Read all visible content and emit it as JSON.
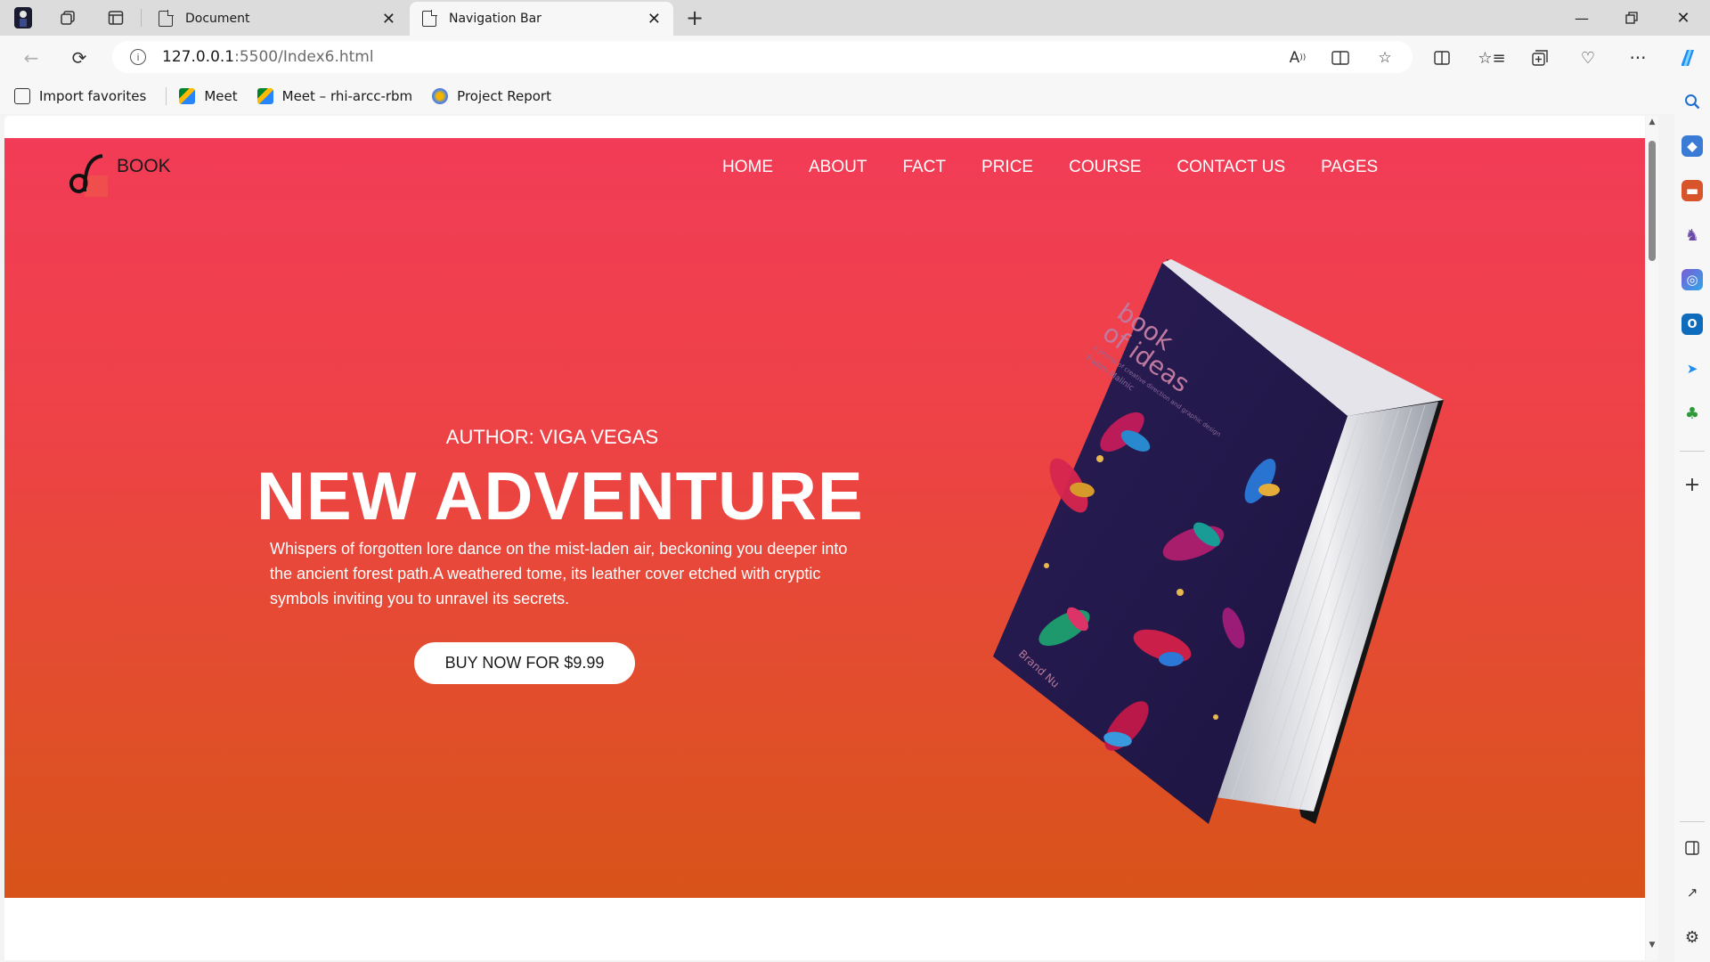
{
  "browser": {
    "tabs": [
      {
        "title": "Document",
        "active": false
      },
      {
        "title": "Navigation Bar",
        "active": true
      }
    ],
    "url_host": "127.0.0.1",
    "url_path": ":5500/Index6.html",
    "favorites": [
      {
        "label": "Import favorites",
        "icon": "import-icon"
      },
      {
        "label": "Meet",
        "icon": "meet-icon"
      },
      {
        "label": "Meet – rhi-arcc-rbm",
        "icon": "meet-icon"
      },
      {
        "label": "Project Report",
        "icon": "report-icon"
      }
    ]
  },
  "page": {
    "brand": "BOOK",
    "menu": [
      "HOME",
      "ABOUT",
      "FACT",
      "PRICE",
      "COURSE",
      "CONTACT US",
      "PAGES"
    ],
    "author": "AUTHOR: VIGA VEGAS",
    "headline": "NEW ADVENTURE",
    "description": "Whispers of forgotten lore dance on the mist-laden air, beckoning you deeper into the ancient forest path.A weathered tome, its leather cover etched with cryptic symbols inviting you to unravel its secrets.",
    "cta": "BUY NOW FOR $9.99",
    "book": {
      "title_line1": "book",
      "title_line2": "of ideas",
      "subtitle": "A journal of creative direction and graphic design",
      "author_small": "Radim Malinic",
      "spine": "Brand Nu"
    },
    "colors": {
      "hero_top": "#f23c57",
      "hero_bottom": "#d85319",
      "book_cover": "#24184a"
    }
  }
}
